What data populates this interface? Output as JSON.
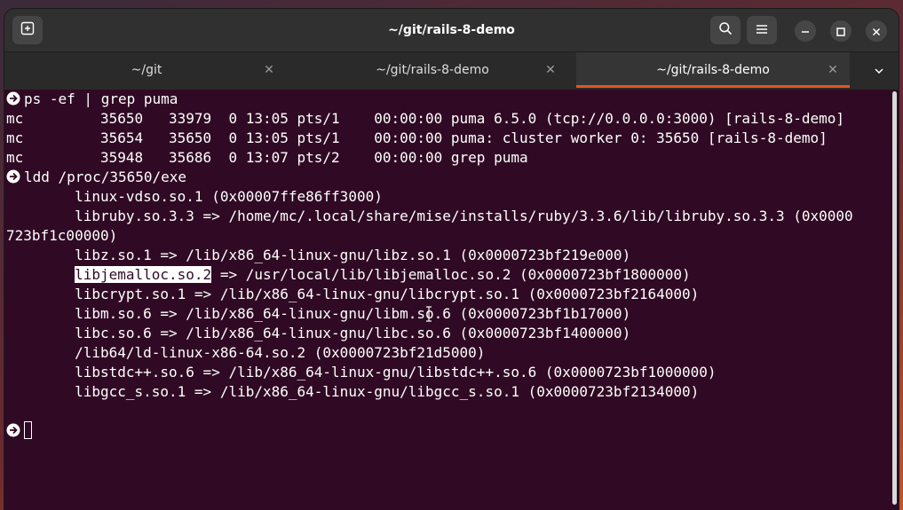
{
  "window": {
    "title": "~/git/rails-8-demo"
  },
  "tabs": [
    {
      "label": "~/git",
      "active": false
    },
    {
      "label": "~/git/rails-8-demo",
      "active": false
    },
    {
      "label": "~/git/rails-8-demo",
      "active": true
    }
  ],
  "colors": {
    "terminal_bg": "#300a24",
    "accent": "#e95420",
    "titlebar_bg": "#303030"
  },
  "terminal": {
    "lines": [
      {
        "prompt": true,
        "text": "ps -ef | grep puma"
      },
      {
        "prompt": false,
        "text": "mc         35650   33979  0 13:05 pts/1    00:00:00 puma 6.5.0 (tcp://0.0.0.0:3000) [rails-8-demo]"
      },
      {
        "prompt": false,
        "text": "mc         35654   35650  0 13:05 pts/1    00:00:00 puma: cluster worker 0: 35650 [rails-8-demo]"
      },
      {
        "prompt": false,
        "text": "mc         35948   35686  0 13:07 pts/2    00:00:00 grep puma"
      },
      {
        "prompt": true,
        "text": "ldd /proc/35650/exe"
      },
      {
        "prompt": false,
        "text": "        linux-vdso.so.1 (0x00007ffe86ff3000)"
      },
      {
        "prompt": false,
        "text": "        libruby.so.3.3 => /home/mc/.local/share/mise/installs/ruby/3.3.6/lib/libruby.so.3.3 (0x0000"
      },
      {
        "prompt": false,
        "text": "723bf1c00000)"
      },
      {
        "prompt": false,
        "text": "        libz.so.1 => /lib/x86_64-linux-gnu/libz.so.1 (0x0000723bf219e000)"
      },
      {
        "prompt": false,
        "text": "        ",
        "selected": "libjemalloc.so.2",
        "rest": " => /usr/local/lib/libjemalloc.so.2 (0x0000723bf1800000)"
      },
      {
        "prompt": false,
        "text": "        libcrypt.so.1 => /lib/x86_64-linux-gnu/libcrypt.so.1 (0x0000723bf2164000)"
      },
      {
        "prompt": false,
        "text": "        libm.so.6 => /lib/x86_64-linux-gnu/libm.so.6 (0x0000723bf1b17000)"
      },
      {
        "prompt": false,
        "text": "        libc.so.6 => /lib/x86_64-linux-gnu/libc.so.6 (0x0000723bf1400000)"
      },
      {
        "prompt": false,
        "text": "        /lib64/ld-linux-x86-64.so.2 (0x0000723bf21d5000)"
      },
      {
        "prompt": false,
        "text": "        libstdc++.so.6 => /lib/x86_64-linux-gnu/libstdc++.so.6 (0x0000723bf1000000)"
      },
      {
        "prompt": false,
        "text": "        libgcc_s.so.1 => /lib/x86_64-linux-gnu/libgcc_s.so.1 (0x0000723bf2134000)"
      },
      {
        "prompt": false,
        "text": ""
      },
      {
        "prompt": true,
        "text": "",
        "cursor": true
      }
    ]
  },
  "icons": {
    "new_tab": "new-tab-icon",
    "search": "search-icon",
    "menu": "hamburger-menu-icon",
    "minimize": "minimize-icon",
    "maximize": "maximize-icon",
    "close": "close-icon",
    "tab_close": "tab-close-icon",
    "tab_list": "chevron-down-icon",
    "prompt": "arrow-right-circle-icon"
  }
}
